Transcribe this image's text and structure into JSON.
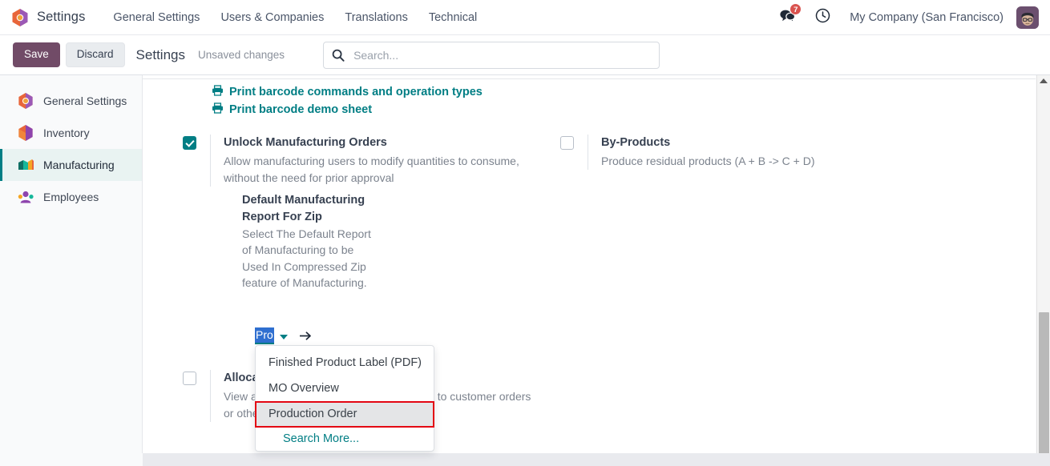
{
  "navbar": {
    "brand_icon": "odoo-settings-logo-icon",
    "app_name": "Settings",
    "menu_items": [
      {
        "label": "General Settings",
        "name": "menu-general-settings"
      },
      {
        "label": "Users & Companies",
        "name": "menu-users-companies"
      },
      {
        "label": "Translations",
        "name": "menu-translations"
      },
      {
        "label": "Technical",
        "name": "menu-technical"
      }
    ],
    "messages": {
      "icon": "messages-icon",
      "badge_count": "7"
    },
    "activities": {
      "icon": "clock-icon"
    },
    "company": "My Company (San Francisco)",
    "avatar": {
      "icon": "user-avatar"
    }
  },
  "control_panel": {
    "save_label": "Save",
    "discard_label": "Discard",
    "title": "Settings",
    "status": "Unsaved changes",
    "search": {
      "placeholder": "Search...",
      "value": "",
      "icon": "search-icon"
    }
  },
  "sidebar": {
    "items": [
      {
        "label": "General Settings",
        "icon": "settings-app-icon",
        "active": false
      },
      {
        "label": "Inventory",
        "icon": "inventory-app-icon",
        "active": false
      },
      {
        "label": "Manufacturing",
        "icon": "manufacturing-app-icon",
        "active": true
      },
      {
        "label": "Employees",
        "icon": "employees-app-icon",
        "active": false
      }
    ]
  },
  "main": {
    "barcode_links": [
      {
        "label": "Print barcode commands and operation types",
        "icon": "printer-icon"
      },
      {
        "label": "Print barcode demo sheet",
        "icon": "printer-icon"
      }
    ],
    "settings": [
      {
        "name": "unlock-manufacturing-orders",
        "title": "Unlock Manufacturing Orders",
        "description": "Allow manufacturing users to modify quantities to consume, without the need for prior approval",
        "checked": true
      },
      {
        "name": "by-products",
        "title": "By-Products",
        "description": "Produce residual products (A + B -> C + D)",
        "checked": false
      },
      {
        "name": "allocation-reports",
        "title": "Allocation Reports",
        "description": "View and allocate manufactured quantities to customer orders or other manufacturing orders",
        "checked": false
      }
    ],
    "nested_field": {
      "label": "Default Manufacturing Report For Zip",
      "help": "Select The Default Report of Manufacturing to be Used In Compressed Zip feature of Manufacturing.",
      "value": "Pro",
      "caret_icon": "chevron-down-icon",
      "internal_link_icon": "arrow-right-icon"
    },
    "dropdown": {
      "options": [
        {
          "label": "Finished Product Label (PDF)",
          "highlighted": false,
          "annotated": false
        },
        {
          "label": "MO Overview",
          "highlighted": false,
          "annotated": false
        },
        {
          "label": "Production Order",
          "highlighted": true,
          "annotated": true
        }
      ],
      "search_more_label": "Search More..."
    }
  },
  "scrollbar": {
    "up_arrow_icon": "caret-up-icon",
    "thumb": "vertical-scroll-thumb"
  },
  "colors": {
    "primary": "#714b67",
    "accent_teal": "#017e84",
    "badge_red": "#d9534f",
    "annotation_red": "#e30613",
    "selection_blue": "#2f6fd0"
  }
}
